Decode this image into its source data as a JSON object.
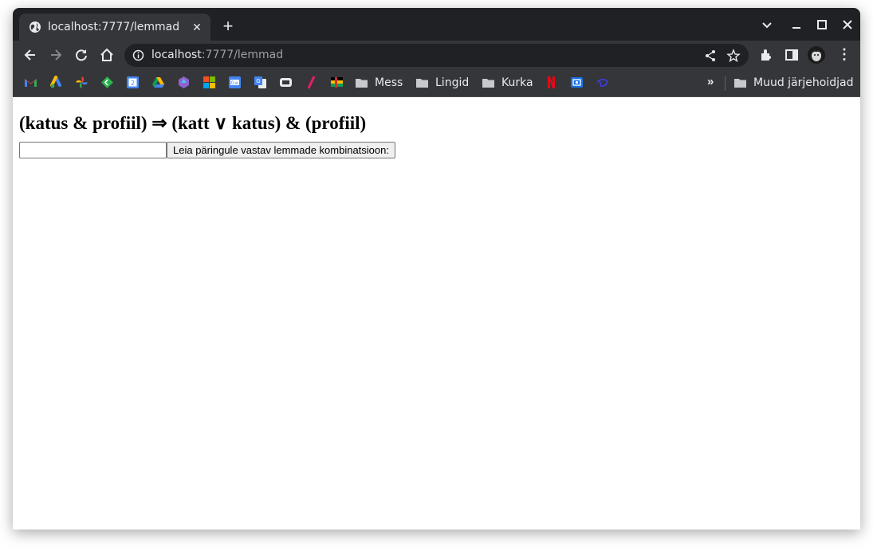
{
  "browser": {
    "tab": {
      "title": "localhost:7777/lemmad",
      "close": "✕"
    },
    "new_tab": "+",
    "window_controls": {
      "tabsearch": "⌄",
      "minimize": "–",
      "maximize": "□",
      "close": "✕"
    },
    "address": {
      "host": "localhost",
      "path": ":7777/lemmad"
    },
    "menu": "⋮"
  },
  "bookmarks": {
    "apps": [
      {
        "name": "gmail-icon",
        "color": "#ea4335"
      },
      {
        "name": "google-ads-icon",
        "color": "#4285f4"
      },
      {
        "name": "google-photos-icon",
        "color": "#fbbc04"
      },
      {
        "name": "feedly-icon",
        "color": "#2bb24c"
      },
      {
        "name": "google-calendar-icon",
        "color": "#4285f4"
      },
      {
        "name": "google-drive-icon",
        "color": "#0f9d58"
      },
      {
        "name": "app-icon",
        "color": "#8e63ce"
      },
      {
        "name": "microsoft-icon",
        "color": "#f25022"
      },
      {
        "name": "google-sheets-translate-icon",
        "color": "#4285f4"
      },
      {
        "name": "google-translate-icon",
        "color": "#4285f4"
      },
      {
        "name": "puzzle-icon",
        "color": "#e8eaed"
      },
      {
        "name": "slash-icon",
        "color": "#e91e63"
      },
      {
        "name": "flag-icon",
        "color": "#000000"
      }
    ],
    "folders": [
      "Mess",
      "Lingid",
      "Kurka"
    ],
    "apps_after": [
      {
        "name": "netflix-icon",
        "color": "#e50914"
      },
      {
        "name": "outlook-icon",
        "color": "#1a73e8"
      },
      {
        "name": "disney-icon",
        "color": "#3c3ce6"
      }
    ],
    "overflow": "»",
    "other_folder": "Muud järjehoidjad"
  },
  "page": {
    "heading": "(katus & profiil) ⇒ (katt ∨ katus) & (profiil)",
    "query_input": {
      "value": "",
      "placeholder": ""
    },
    "submit_label": "Leia päringule vastav lemmade kombinatsioon:"
  },
  "colors": {
    "tabstrip": "#202124",
    "toolbar": "#35363a",
    "text_light": "#e8eaed"
  }
}
